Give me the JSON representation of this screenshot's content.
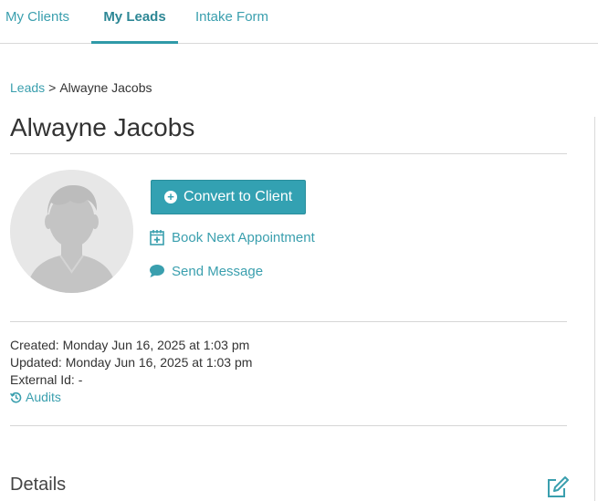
{
  "tabs": [
    {
      "label": "My Clients",
      "active": false
    },
    {
      "label": "My Leads",
      "active": true
    },
    {
      "label": "Intake Form",
      "active": false
    }
  ],
  "breadcrumb": {
    "parent": "Leads",
    "separator": ">",
    "current": "Alwayne Jacobs"
  },
  "lead": {
    "name": "Alwayne Jacobs"
  },
  "actions": {
    "convert_label": "Convert to Client",
    "book_label": "Book Next Appointment",
    "message_label": "Send Message"
  },
  "meta": {
    "created": "Created: Monday Jun 16, 2025 at 1:03 pm",
    "updated": "Updated: Monday Jun 16, 2025 at 1:03 pm",
    "external_id": "External Id: -",
    "audits_label": "Audits"
  },
  "details": {
    "heading": "Details"
  },
  "colors": {
    "accent": "#33a1b2",
    "link": "#3a9fae",
    "avatar_bg": "#e7e7e7"
  },
  "icons": [
    "plus-circle-icon",
    "calendar-plus-icon",
    "chat-bubble-icon",
    "history-icon",
    "edit-icon",
    "avatar-placeholder"
  ]
}
